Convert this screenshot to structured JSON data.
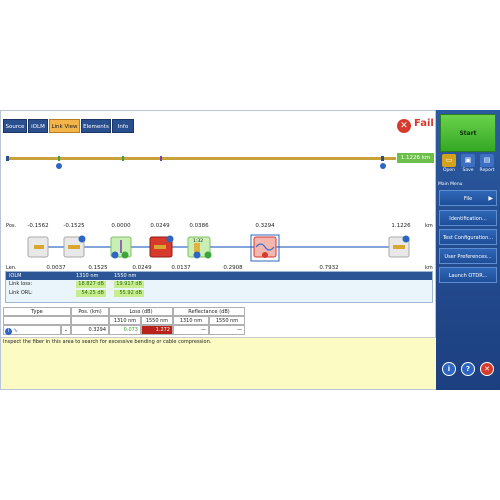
{
  "tabs": [
    {
      "label": "Source",
      "active": false
    },
    {
      "label": "iOLM",
      "active": false
    },
    {
      "label": "Link View",
      "active": true
    },
    {
      "label": "Elements",
      "active": false
    },
    {
      "label": "Info",
      "active": false
    }
  ],
  "status": {
    "text": "Fail",
    "icon": "fail-x-icon",
    "color": "#d63a2c"
  },
  "overview": {
    "total_km": "1.1226 km"
  },
  "axis": {
    "pos_label": "Pos.",
    "len_label": "Len.",
    "unit_top": "km",
    "unit_bottom": "km"
  },
  "positions": [
    "-0.1562",
    "-0.1525",
    "0.0000",
    "0.0249",
    "0.0386",
    "0.3294",
    "1.1226"
  ],
  "lengths": [
    "0.0037",
    "0.1525",
    "0.0249",
    "0.0137",
    "0.2908",
    "0.7932"
  ],
  "event_icons": [
    "connector-launch-icon",
    "connector-icon",
    "splice-pass-icon",
    "connector-fail-icon",
    "splitter-1x32-pass-icon",
    "macrobend-fail-icon",
    "connector-end-icon"
  ],
  "splitter_ratio": "1:32",
  "summary": {
    "header": "iOLM",
    "col_1310": "1310 nm",
    "col_1550": "1550 nm",
    "rows": [
      {
        "label": "Link loss:",
        "v1310": "18.827 dB",
        "v1550": "19.917 dB"
      },
      {
        "label": "Link ORL:",
        "v1310": "54.25 dB",
        "v1550": "55.92 dB"
      }
    ]
  },
  "event_table": {
    "headers": {
      "type": "Type",
      "pos": "Pos. (km)",
      "loss": "Loss (dB)",
      "refl": "Reflectance (dB)",
      "sub_1310": "1310 nm",
      "sub_1550": "1550 nm",
      "sub_r1310": "1310 nm",
      "sub_r1550": "1550 nm"
    },
    "row": {
      "pos": "0.3294",
      "loss_1310": "0.073",
      "loss_1550": "1.272",
      "refl_1310": "—",
      "refl_1550": "—"
    }
  },
  "comment": "Inspect the fiber in this area to search for excessive bending or cable compression.",
  "sidebar": {
    "start": "Start",
    "tools": [
      {
        "label": "Open",
        "icon": "folder-open-icon",
        "color": "#d4a21d"
      },
      {
        "label": "Save",
        "icon": "save-icon",
        "color": "#3c6fc1"
      },
      {
        "label": "Report",
        "icon": "report-icon",
        "color": "#3c6fc1"
      }
    ],
    "menu_title": "Main Menu",
    "menu": [
      "File",
      "Identification...",
      "Test Configuration...",
      "User Preferences...",
      "Launch OTDR..."
    ],
    "round_buttons": [
      {
        "glyph": "i",
        "icon": "info-icon",
        "color": "#2c66c2"
      },
      {
        "glyph": "?",
        "icon": "help-icon",
        "color": "#2c66c2"
      },
      {
        "glyph": "✕",
        "icon": "exit-icon",
        "color": "#d63a2c"
      }
    ]
  }
}
